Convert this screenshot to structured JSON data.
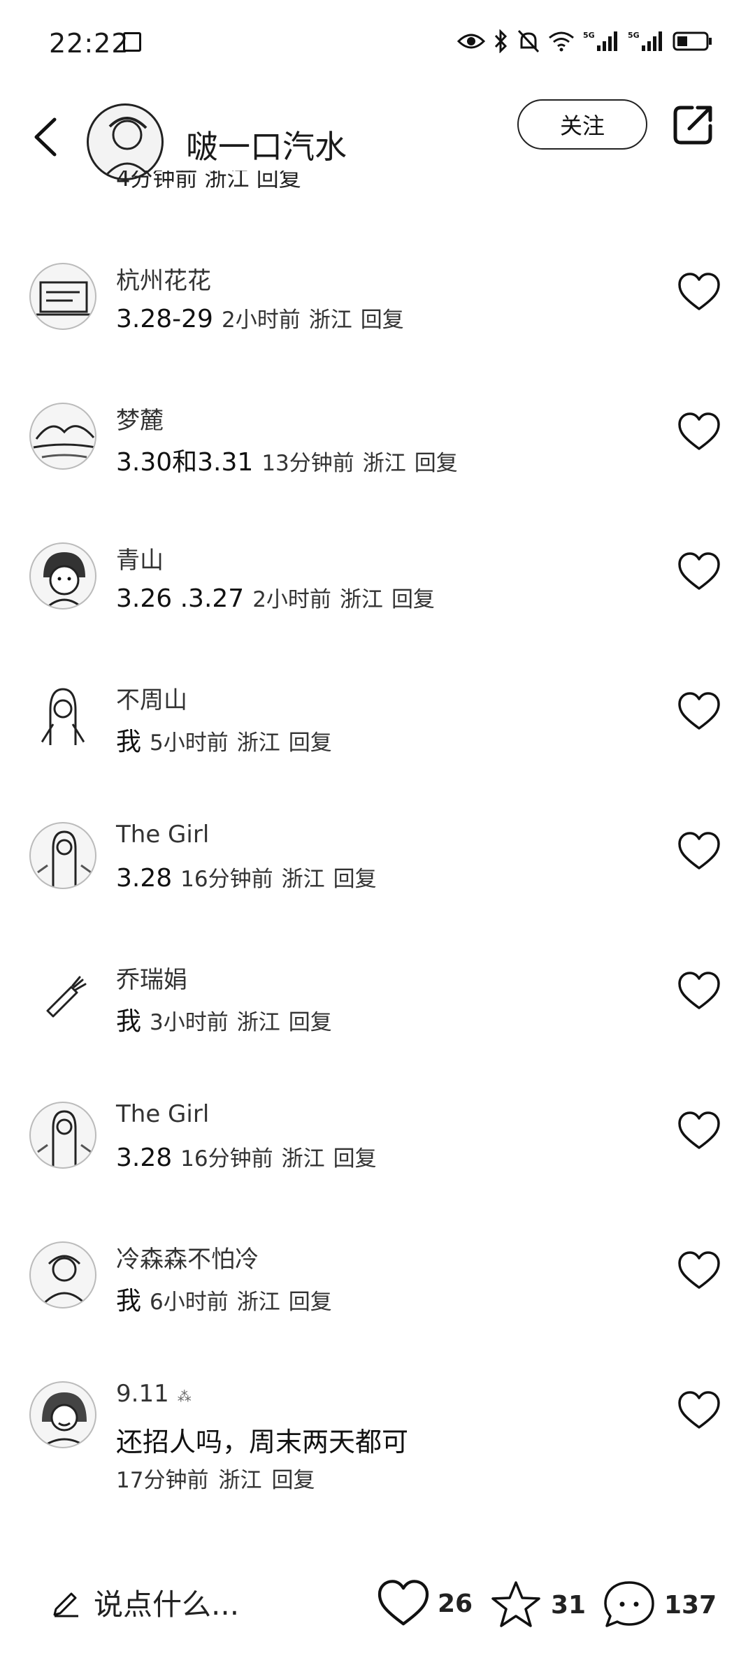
{
  "status_bar": {
    "time": "22:22",
    "icons": [
      "eye-icon",
      "bluetooth-icon",
      "mute-icon",
      "wifi-icon",
      "signal-5g-icon",
      "signal-5g-icon",
      "battery-icon"
    ]
  },
  "header": {
    "author_name": "啵一口汽水",
    "follow_label": "关注"
  },
  "partial_line": "4分钟前  浙江  回复",
  "comments": [
    {
      "name": "杭州花花",
      "text": "3.28-29",
      "time": "2小时前",
      "location": "浙江",
      "reply": "回复"
    },
    {
      "name": "梦麓",
      "text": "3.30和3.31",
      "time": "13分钟前",
      "location": "浙江",
      "reply": "回复"
    },
    {
      "name": "青山",
      "text": "3.26  .3.27",
      "time": "2小时前",
      "location": "浙江",
      "reply": "回复"
    },
    {
      "name": "不周山",
      "text": "我",
      "time": "5小时前",
      "location": "浙江",
      "reply": "回复"
    },
    {
      "name": "The Girl",
      "text": "3.28",
      "time": "16分钟前",
      "location": "浙江",
      "reply": "回复"
    },
    {
      "name": "乔瑞娟",
      "text": "我",
      "time": "3小时前",
      "location": "浙江",
      "reply": "回复"
    },
    {
      "name": "The Girl",
      "text": "3.28",
      "time": "16分钟前",
      "location": "浙江",
      "reply": "回复"
    },
    {
      "name": "冷森森不怕冷",
      "text": "我",
      "time": "6小时前",
      "location": "浙江",
      "reply": "回复"
    },
    {
      "name": "9.11",
      "badge": "⁂",
      "text": "还招人吗，周末两天都可",
      "time": "17分钟前",
      "location": "浙江",
      "reply": "回复"
    }
  ],
  "bottom_bar": {
    "placeholder": "说点什么...",
    "likes": "26",
    "stars": "31",
    "comments": "137"
  }
}
